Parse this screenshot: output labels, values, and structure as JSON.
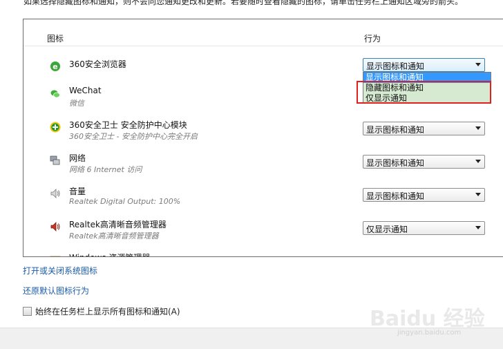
{
  "intro_text": "如果选择隐藏图标和通知，则不会向您通知更改和更新。若要随时查看隐藏的图标，请单击任务栏上通知区域旁的箭头。",
  "table": {
    "col_icon": "图标",
    "col_behavior": "行为",
    "rows": [
      {
        "name": "360安全浏览器",
        "subtitle": "",
        "behavior": "显示图标和通知",
        "icon": "ie-browser-icon"
      },
      {
        "name": "WeChat",
        "subtitle": "微信",
        "behavior": "",
        "icon": "wechat-icon"
      },
      {
        "name": "360安全卫士 安全防护中心模块",
        "subtitle": "360安全卫士 - 安全防护中心完全开启",
        "behavior": "显示图标和通知",
        "icon": "360-shield-icon"
      },
      {
        "name": "网络",
        "subtitle": "网络 6 Internet 访问",
        "behavior": "显示图标和通知",
        "icon": "network-icon"
      },
      {
        "name": "音量",
        "subtitle": "Realtek Digital Output: 100%",
        "behavior": "显示图标和通知",
        "icon": "volume-icon"
      },
      {
        "name": "Realtek高清晰音频管理器",
        "subtitle": "Realtek高清晰音频管理器",
        "behavior": "仅显示通知",
        "icon": "speaker-icon"
      },
      {
        "name": "Windows 资源管理器",
        "subtitle": "",
        "behavior": "",
        "icon": "explorer-icon"
      }
    ]
  },
  "dropdown_options": [
    "显示图标和通知",
    "隐藏图标和通知",
    "仅显示通知"
  ],
  "links": {
    "system_icons": "打开或关闭系统图标",
    "restore_default": "还原默认图标行为"
  },
  "checkbox_label": "始终在任务栏上显示所有图标和通知(A)",
  "watermark": "Baidu 经验",
  "watermark_url": "jingyan.baidu.com",
  "colors": {
    "link": "#1a5ba6",
    "highlight": "#d6ead2",
    "annotation": "#e0201c",
    "selected": "#3399ff"
  }
}
